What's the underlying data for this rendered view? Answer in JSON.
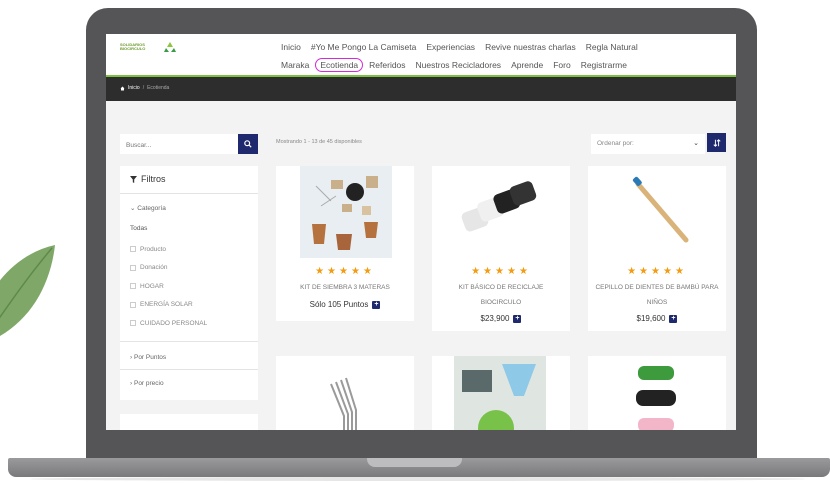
{
  "site": {
    "logo_text": "SOLIDARIOS BIOCIRCULO"
  },
  "nav": {
    "row1": [
      "Inicio",
      "#Yo Me Pongo La Camiseta",
      "Experiencias",
      "Revive nuestras charlas",
      "Regla Natural"
    ],
    "row2": [
      "Maraka",
      "Ecotienda",
      "Referidos",
      "Nuestros Recicladores",
      "Aprende",
      "Foro",
      "Registrarme"
    ],
    "active": "Ecotienda"
  },
  "breadcrumb": {
    "home": "Inicio",
    "current": "Ecotienda"
  },
  "search": {
    "placeholder": "Buscar..."
  },
  "filters": {
    "title": "Filtros",
    "category_heading": "Categoría",
    "all_label": "Todas",
    "categories": [
      "Producto",
      "Donación",
      "HOGAR",
      "ENERGÍA SOLAR",
      "CUIDADO PERSONAL"
    ],
    "by_points": "Por Puntos",
    "by_price": "Por precio"
  },
  "results": {
    "count_text": "Mostrando 1 - 13 de 45 disponibles",
    "sort_placeholder": "Ordenar por:"
  },
  "products": [
    {
      "name": "KIT DE SIEMBRA 3 MATERAS",
      "price": "Sólo 105 Puntos",
      "stars": "★★★★★"
    },
    {
      "name": "KIT BÁSICO DE RECICLAJE BIOCIRCULO",
      "price": "$23,900",
      "stars": "★★★★★"
    },
    {
      "name": "CEPILLO DE DIENTES DE BAMBÚ PARA NIÑOS",
      "price": "$19,600",
      "stars": "★★★★★"
    }
  ],
  "colors": {
    "accent": "#1f2a6e",
    "green": "#7cc242",
    "star": "#f39c12",
    "highlight": "#d52ad8"
  }
}
